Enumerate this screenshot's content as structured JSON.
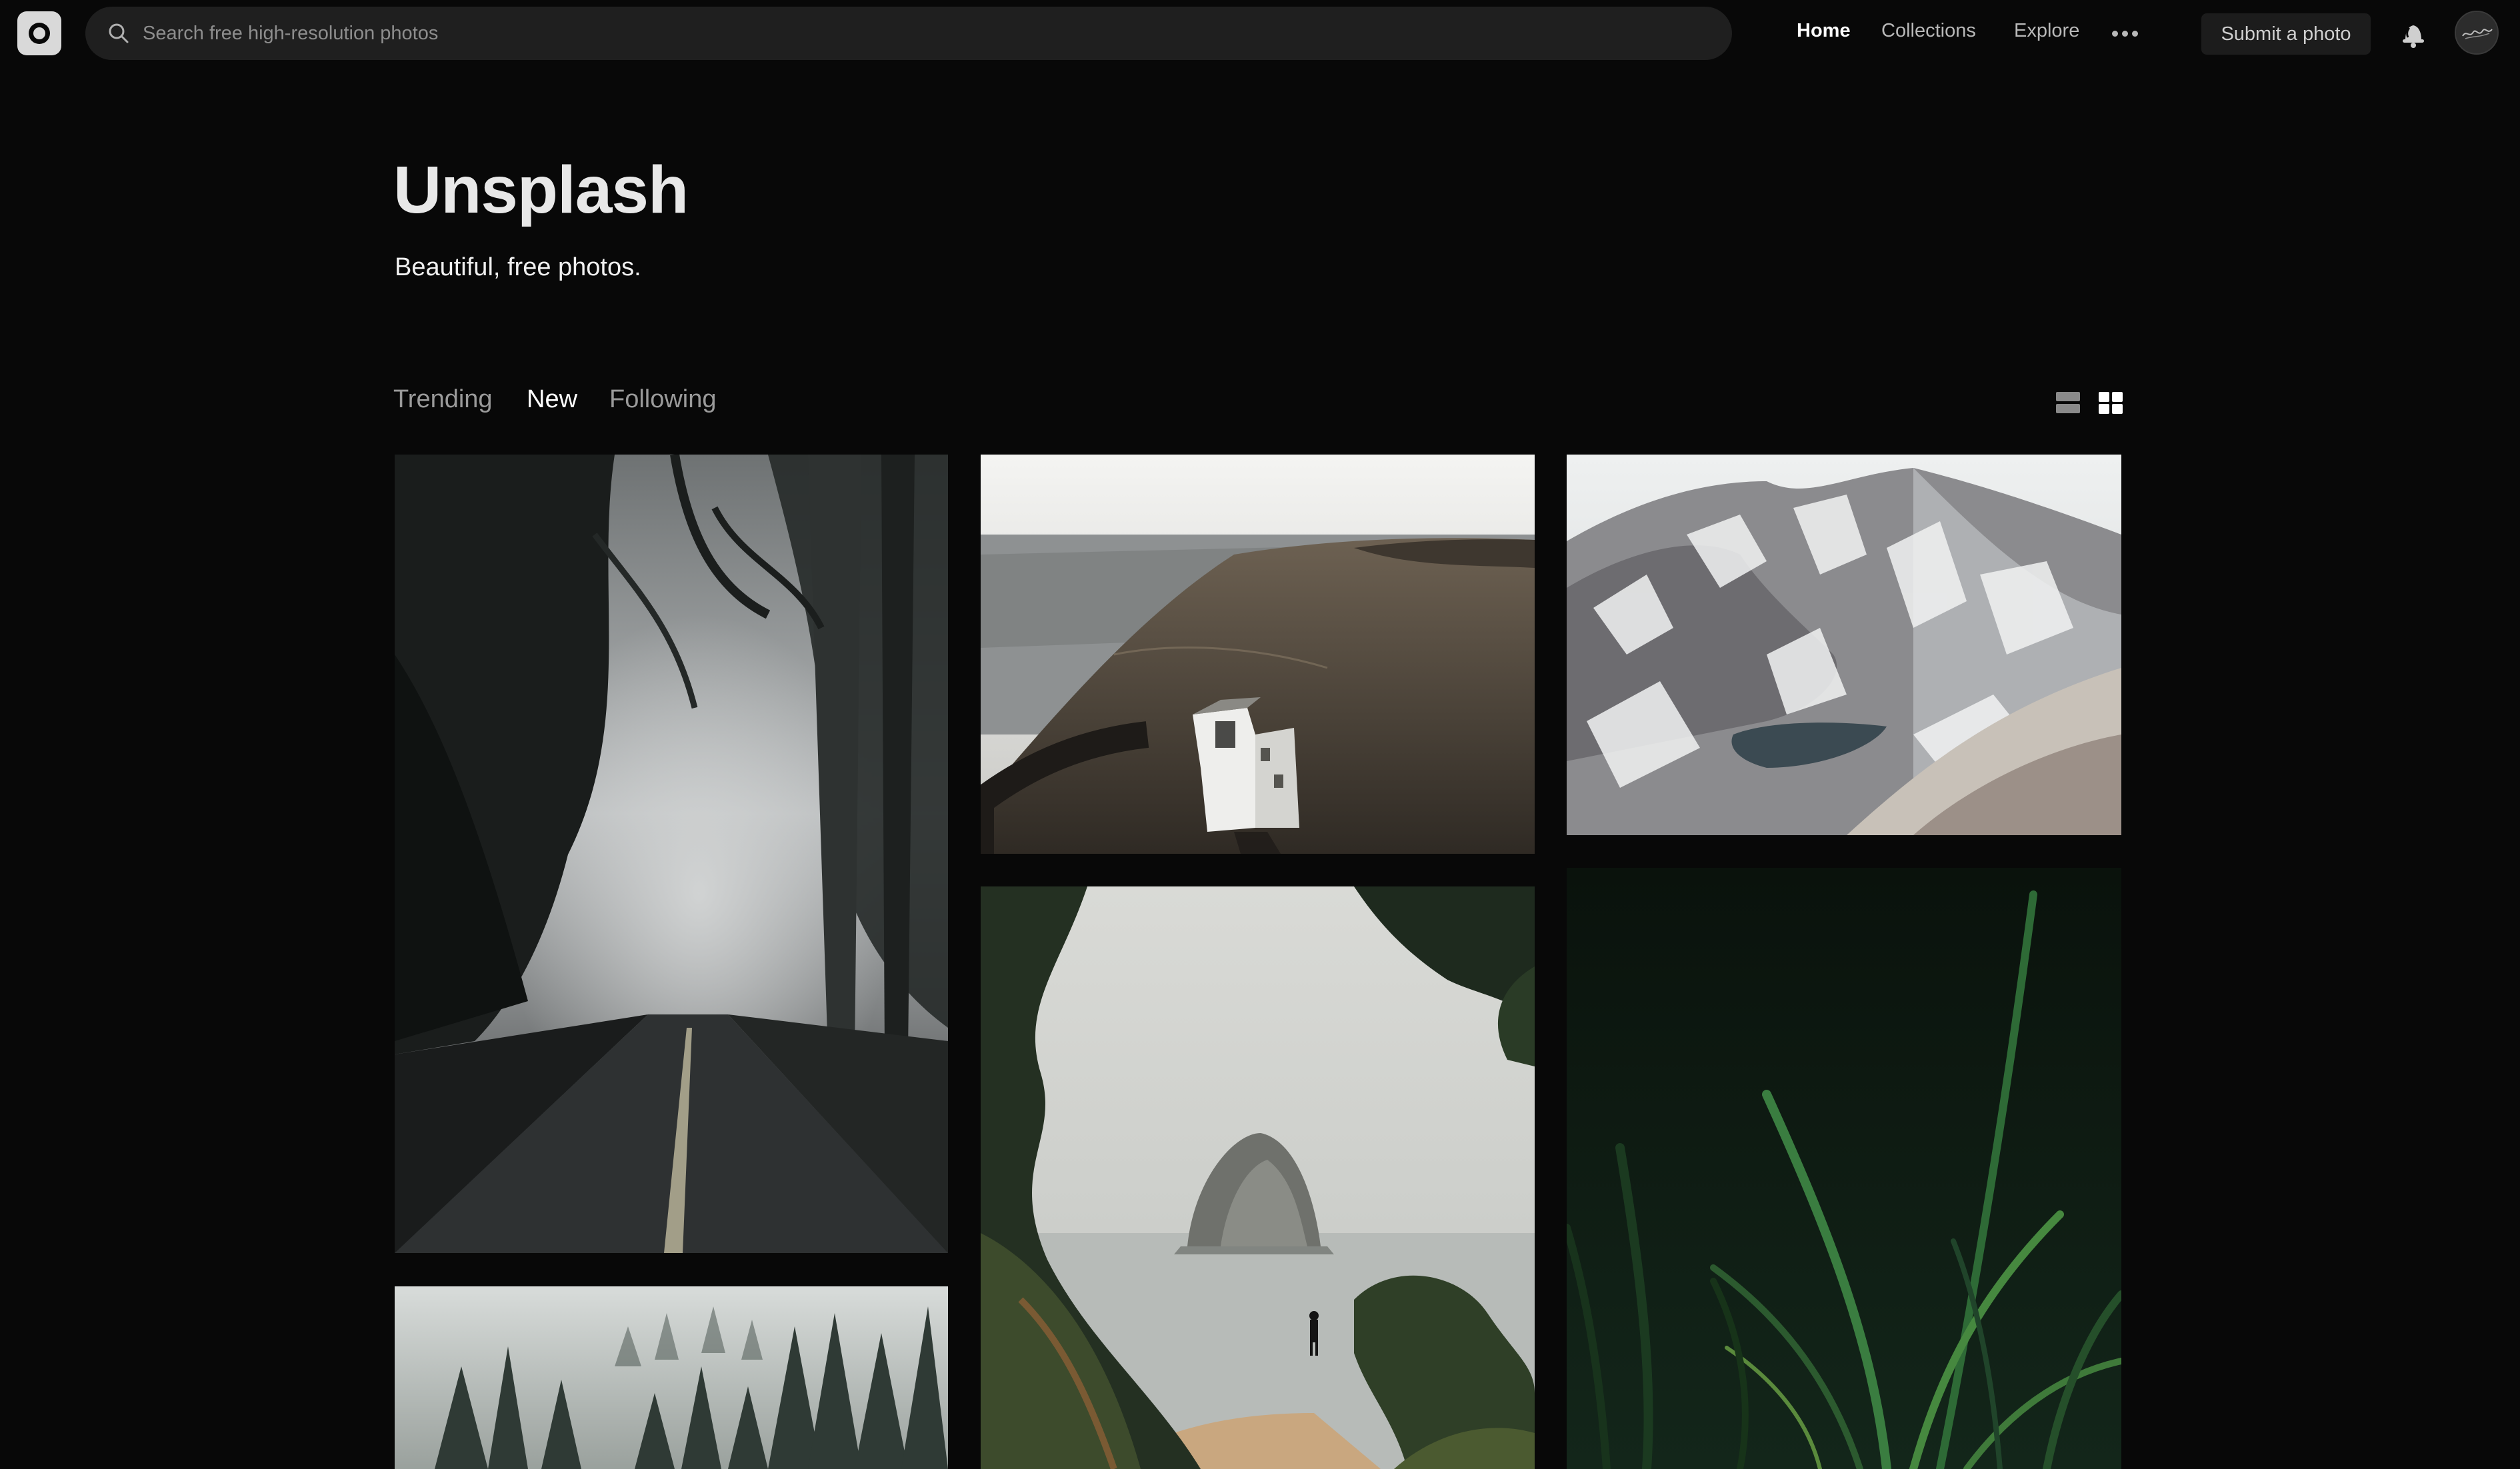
{
  "header": {
    "logo_icon": "camera-icon",
    "search": {
      "placeholder": "Search free high-resolution photos",
      "value": ""
    },
    "nav": [
      {
        "label": "Home",
        "active": true
      },
      {
        "label": "Collections",
        "active": false
      },
      {
        "label": "Explore",
        "active": false
      }
    ],
    "more_icon": "more-dots-icon",
    "submit_label": "Submit a photo",
    "notifications_icon": "bell-icon",
    "avatar_icon": "user-avatar"
  },
  "hero": {
    "title": "Unsplash",
    "subtitle": "Beautiful, free photos."
  },
  "feed": {
    "tabs": [
      {
        "label": "Trending",
        "active": false
      },
      {
        "label": "New",
        "active": true
      },
      {
        "label": "Following",
        "active": false
      }
    ],
    "view_icons": [
      "list-view-icon",
      "grid-view-icon"
    ],
    "photos": [
      {
        "subject": "foggy-forest-road"
      },
      {
        "subject": "coastal-cliff-house"
      },
      {
        "subject": "snowy-mountain-lake"
      },
      {
        "subject": "misty-pine-forest"
      },
      {
        "subject": "sea-stack-beach"
      },
      {
        "subject": "green-grass-closeup"
      }
    ]
  },
  "colors": {
    "background": "#080808",
    "search_bg": "#1f1f1f",
    "active_text": "#ffffff",
    "muted_text": "#9a9a9a"
  }
}
